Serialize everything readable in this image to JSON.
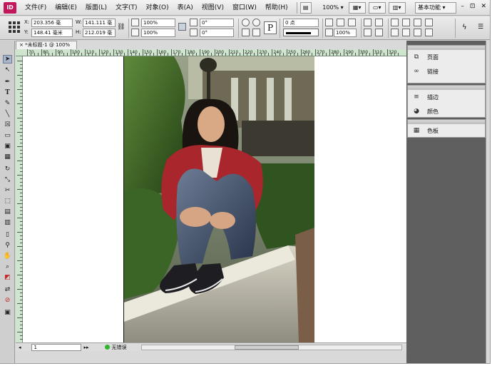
{
  "app": {
    "logo": "ID",
    "menu": [
      "文件(F)",
      "编辑(E)",
      "版面(L)",
      "文字(T)",
      "对象(O)",
      "表(A)",
      "视图(V)",
      "窗口(W)",
      "帮助(H)"
    ],
    "zoom": "100%",
    "workspace": "基本功能",
    "window_controls": [
      "–",
      "⊡",
      "✕"
    ]
  },
  "control_panel": {
    "x_label": "X:",
    "x_value": "203.356 毫",
    "y_label": "Y:",
    "y_value": "148.41 毫米",
    "w_label": "W:",
    "w_value": "141.111 毫",
    "h_label": "H:",
    "h_value": "212.019 毫",
    "scale_x": "100%",
    "scale_y": "100%",
    "rotate": "0°",
    "shear": "0°",
    "stroke_weight": "0 点",
    "opacity": "100%"
  },
  "document": {
    "tab_title": "*未标题-1 @ 100%",
    "tab_close": "×",
    "ruler_labels": [
      "70",
      "80",
      "90",
      "100",
      "110",
      "120",
      "130",
      "140",
      "150",
      "160",
      "170",
      "180",
      "190",
      "200",
      "210",
      "220",
      "230",
      "240",
      "250",
      "260",
      "270",
      "280",
      "290",
      "300",
      "310",
      "320"
    ],
    "page_number": "1",
    "status": "无错误"
  },
  "panels": [
    {
      "name": "页面",
      "icon": "pages-icon"
    },
    {
      "name": "链接",
      "icon": "links-icon"
    },
    {
      "name": "描边",
      "icon": "stroke-icon"
    },
    {
      "name": "颜色",
      "icon": "color-icon"
    },
    {
      "name": "色板",
      "icon": "swatches-icon"
    }
  ]
}
